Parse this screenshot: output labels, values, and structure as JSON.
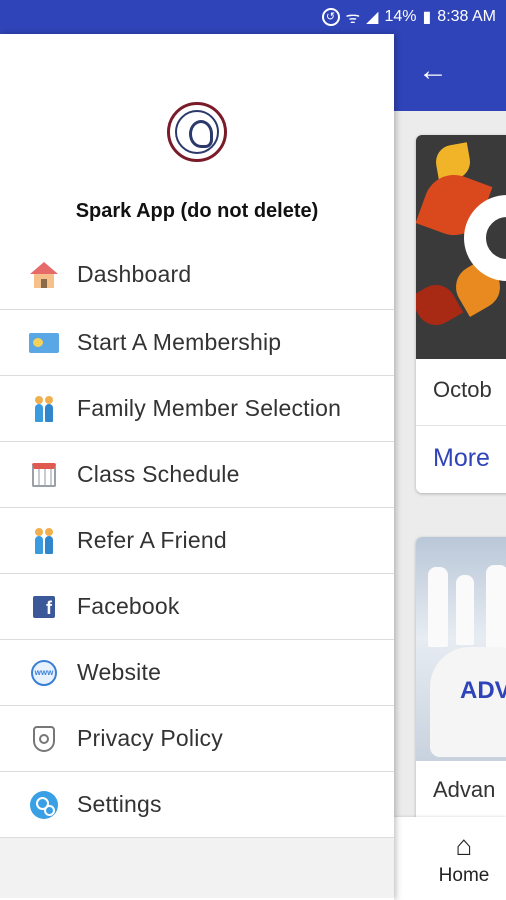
{
  "status_bar": {
    "battery": "14%",
    "time": "8:38 AM"
  },
  "background_app": {
    "cards": [
      {
        "title": "Octob",
        "link": "More"
      },
      {
        "title": "Advan",
        "image_text": "ADV"
      }
    ],
    "bottom_nav": {
      "home_label": "Home"
    }
  },
  "drawer": {
    "app_name": "Spark App (do not delete)",
    "items": [
      {
        "label": "Dashboard",
        "icon": "house-icon"
      },
      {
        "label": "Start A Membership",
        "icon": "membership-card-icon"
      },
      {
        "label": "Family Member Selection",
        "icon": "family-icon"
      },
      {
        "label": "Class Schedule",
        "icon": "calendar-icon"
      },
      {
        "label": "Refer A Friend",
        "icon": "people-icon"
      },
      {
        "label": "Facebook",
        "icon": "facebook-icon"
      },
      {
        "label": "Website",
        "icon": "globe-icon"
      },
      {
        "label": "Privacy Policy",
        "icon": "shield-icon"
      },
      {
        "label": "Settings",
        "icon": "gear-icon"
      }
    ]
  },
  "colors": {
    "primary": "#2f44b8",
    "link": "#2f44b8"
  }
}
